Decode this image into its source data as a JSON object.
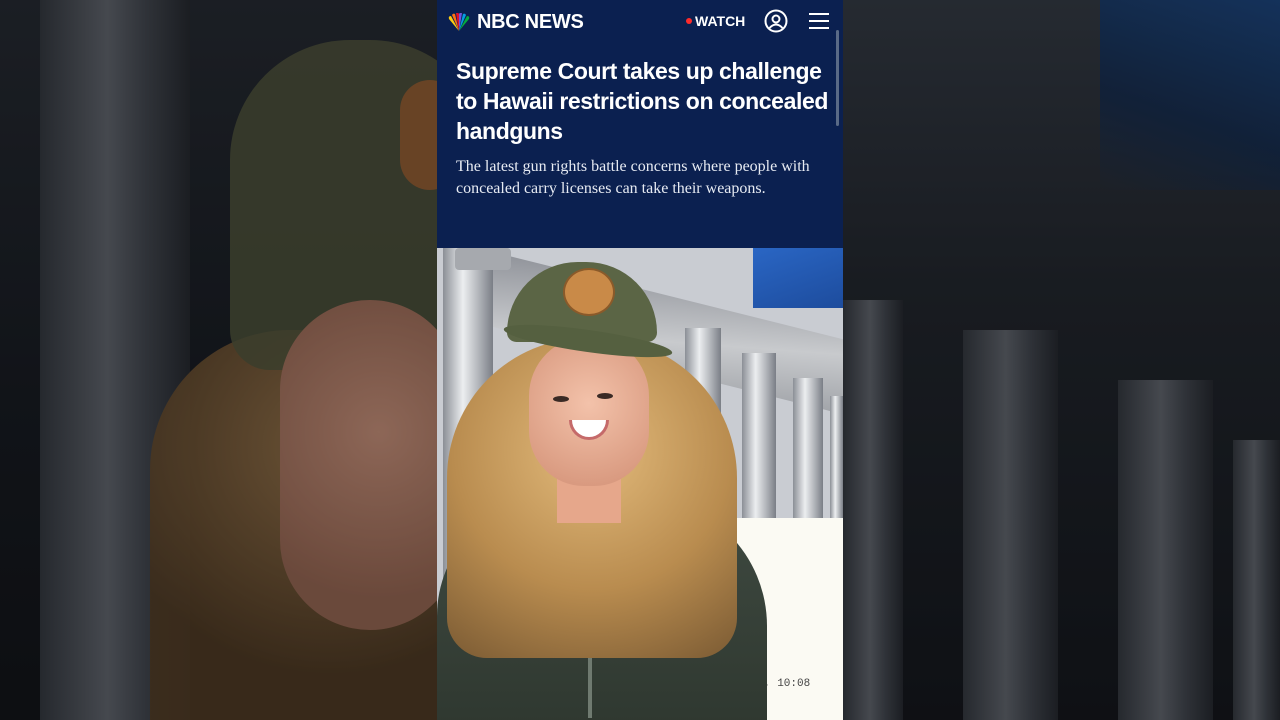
{
  "brand": {
    "name": "NBC NEWS"
  },
  "nav": {
    "watch_label": "WATCH",
    "live_color": "#ff2b2b"
  },
  "article": {
    "headline": "Supreme Court takes up challenge to Hawaii restrictions on concealed handguns",
    "dek": "The latest gun rights battle concerns where people with concealed carry licenses can take their weapons."
  },
  "overlay": {
    "timestamp": ", 10:08"
  },
  "icons": {
    "logo": "peacock-icon",
    "account": "account-circle-icon",
    "menu": "hamburger-menu-icon"
  },
  "colors": {
    "header_bg": "#0b2050",
    "text": "#ffffff"
  }
}
